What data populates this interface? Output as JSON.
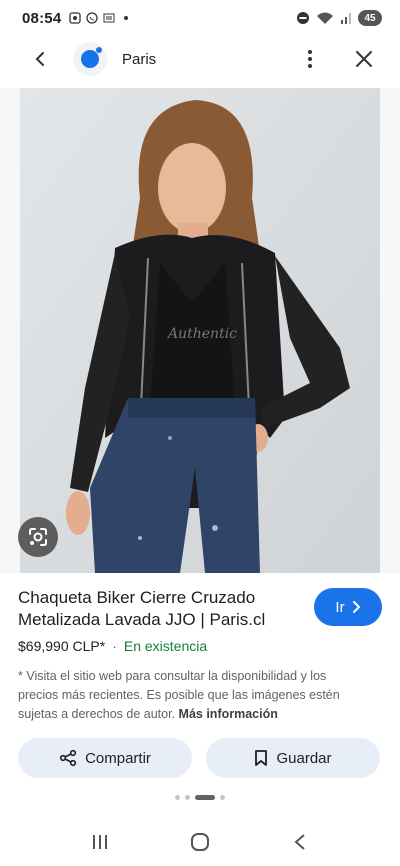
{
  "status_bar": {
    "time": "08:54",
    "battery": "45"
  },
  "app_bar": {
    "site_name": "Paris"
  },
  "product": {
    "title": "Chaqueta Biker Cierre Cruzado Metalizada Lavada JJO | Paris.cl",
    "go_label": "Ir",
    "price": "$69,990 CLP*",
    "separator": "·",
    "stock": "En existencia",
    "disclaimer": "* Visita el sitio web para consultar la disponibilidad y los precios más recientes. Es posible que las imágenes estén sujetas a derechos de autor.",
    "more_info": "Más información"
  },
  "actions": {
    "share_label": "Compartir",
    "save_label": "Guardar"
  },
  "colors": {
    "accent": "#1a73e8",
    "stock_green": "#188038",
    "pill_bg": "#e8eef8"
  }
}
